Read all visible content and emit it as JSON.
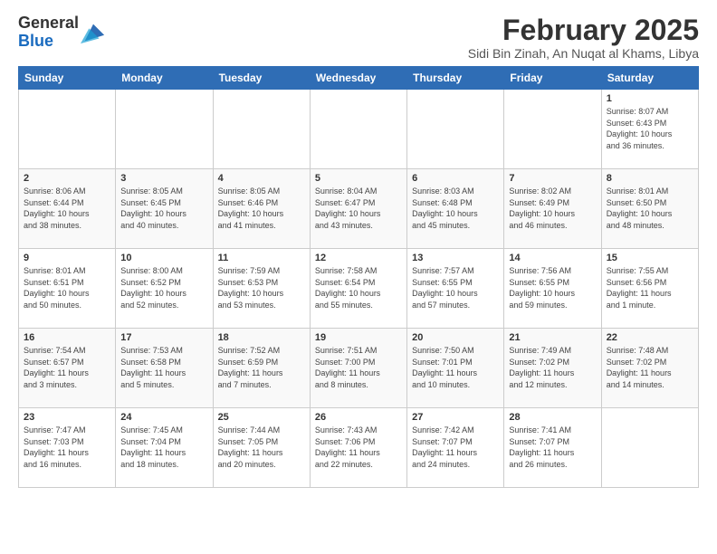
{
  "header": {
    "logo_line1": "General",
    "logo_line2": "Blue",
    "month_title": "February 2025",
    "subtitle": "Sidi Bin Zinah, An Nuqat al Khams, Libya"
  },
  "days_of_week": [
    "Sunday",
    "Monday",
    "Tuesday",
    "Wednesday",
    "Thursday",
    "Friday",
    "Saturday"
  ],
  "weeks": [
    [
      {
        "day": "",
        "info": ""
      },
      {
        "day": "",
        "info": ""
      },
      {
        "day": "",
        "info": ""
      },
      {
        "day": "",
        "info": ""
      },
      {
        "day": "",
        "info": ""
      },
      {
        "day": "",
        "info": ""
      },
      {
        "day": "1",
        "info": "Sunrise: 8:07 AM\nSunset: 6:43 PM\nDaylight: 10 hours\nand 36 minutes."
      }
    ],
    [
      {
        "day": "2",
        "info": "Sunrise: 8:06 AM\nSunset: 6:44 PM\nDaylight: 10 hours\nand 38 minutes."
      },
      {
        "day": "3",
        "info": "Sunrise: 8:05 AM\nSunset: 6:45 PM\nDaylight: 10 hours\nand 40 minutes."
      },
      {
        "day": "4",
        "info": "Sunrise: 8:05 AM\nSunset: 6:46 PM\nDaylight: 10 hours\nand 41 minutes."
      },
      {
        "day": "5",
        "info": "Sunrise: 8:04 AM\nSunset: 6:47 PM\nDaylight: 10 hours\nand 43 minutes."
      },
      {
        "day": "6",
        "info": "Sunrise: 8:03 AM\nSunset: 6:48 PM\nDaylight: 10 hours\nand 45 minutes."
      },
      {
        "day": "7",
        "info": "Sunrise: 8:02 AM\nSunset: 6:49 PM\nDaylight: 10 hours\nand 46 minutes."
      },
      {
        "day": "8",
        "info": "Sunrise: 8:01 AM\nSunset: 6:50 PM\nDaylight: 10 hours\nand 48 minutes."
      }
    ],
    [
      {
        "day": "9",
        "info": "Sunrise: 8:01 AM\nSunset: 6:51 PM\nDaylight: 10 hours\nand 50 minutes."
      },
      {
        "day": "10",
        "info": "Sunrise: 8:00 AM\nSunset: 6:52 PM\nDaylight: 10 hours\nand 52 minutes."
      },
      {
        "day": "11",
        "info": "Sunrise: 7:59 AM\nSunset: 6:53 PM\nDaylight: 10 hours\nand 53 minutes."
      },
      {
        "day": "12",
        "info": "Sunrise: 7:58 AM\nSunset: 6:54 PM\nDaylight: 10 hours\nand 55 minutes."
      },
      {
        "day": "13",
        "info": "Sunrise: 7:57 AM\nSunset: 6:55 PM\nDaylight: 10 hours\nand 57 minutes."
      },
      {
        "day": "14",
        "info": "Sunrise: 7:56 AM\nSunset: 6:55 PM\nDaylight: 10 hours\nand 59 minutes."
      },
      {
        "day": "15",
        "info": "Sunrise: 7:55 AM\nSunset: 6:56 PM\nDaylight: 11 hours\nand 1 minute."
      }
    ],
    [
      {
        "day": "16",
        "info": "Sunrise: 7:54 AM\nSunset: 6:57 PM\nDaylight: 11 hours\nand 3 minutes."
      },
      {
        "day": "17",
        "info": "Sunrise: 7:53 AM\nSunset: 6:58 PM\nDaylight: 11 hours\nand 5 minutes."
      },
      {
        "day": "18",
        "info": "Sunrise: 7:52 AM\nSunset: 6:59 PM\nDaylight: 11 hours\nand 7 minutes."
      },
      {
        "day": "19",
        "info": "Sunrise: 7:51 AM\nSunset: 7:00 PM\nDaylight: 11 hours\nand 8 minutes."
      },
      {
        "day": "20",
        "info": "Sunrise: 7:50 AM\nSunset: 7:01 PM\nDaylight: 11 hours\nand 10 minutes."
      },
      {
        "day": "21",
        "info": "Sunrise: 7:49 AM\nSunset: 7:02 PM\nDaylight: 11 hours\nand 12 minutes."
      },
      {
        "day": "22",
        "info": "Sunrise: 7:48 AM\nSunset: 7:02 PM\nDaylight: 11 hours\nand 14 minutes."
      }
    ],
    [
      {
        "day": "23",
        "info": "Sunrise: 7:47 AM\nSunset: 7:03 PM\nDaylight: 11 hours\nand 16 minutes."
      },
      {
        "day": "24",
        "info": "Sunrise: 7:45 AM\nSunset: 7:04 PM\nDaylight: 11 hours\nand 18 minutes."
      },
      {
        "day": "25",
        "info": "Sunrise: 7:44 AM\nSunset: 7:05 PM\nDaylight: 11 hours\nand 20 minutes."
      },
      {
        "day": "26",
        "info": "Sunrise: 7:43 AM\nSunset: 7:06 PM\nDaylight: 11 hours\nand 22 minutes."
      },
      {
        "day": "27",
        "info": "Sunrise: 7:42 AM\nSunset: 7:07 PM\nDaylight: 11 hours\nand 24 minutes."
      },
      {
        "day": "28",
        "info": "Sunrise: 7:41 AM\nSunset: 7:07 PM\nDaylight: 11 hours\nand 26 minutes."
      },
      {
        "day": "",
        "info": ""
      }
    ]
  ]
}
